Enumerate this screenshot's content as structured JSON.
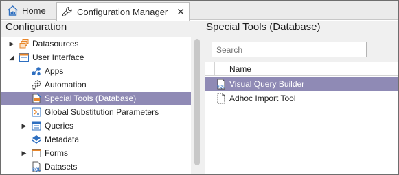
{
  "tabs": [
    {
      "label": "Home",
      "icon": "home-chart-icon"
    },
    {
      "label": "Configuration Manager",
      "icon": "wrench-icon",
      "close": "✕"
    }
  ],
  "left_panel": {
    "title": "Configuration",
    "tree": [
      {
        "label": "Datasources",
        "icon": "datasources-icon",
        "toggle": "▶",
        "level": 0
      },
      {
        "label": "User Interface",
        "icon": "user-interface-icon",
        "toggle": "◢",
        "level": 0
      },
      {
        "label": "Apps",
        "icon": "apps-icon",
        "level": 1
      },
      {
        "label": "Automation",
        "icon": "automation-gear-icon",
        "level": 1
      },
      {
        "label": "Special Tools (Database)",
        "icon": "special-tools-icon",
        "level": 1,
        "selected": true
      },
      {
        "label": "Global Substitution Parameters",
        "icon": "global-parameters-icon",
        "level": 1
      },
      {
        "label": "Queries",
        "icon": "queries-icon",
        "toggle": "▶",
        "level": 1
      },
      {
        "label": "Metadata",
        "icon": "metadata-icon",
        "level": 1
      },
      {
        "label": "Forms",
        "icon": "forms-icon",
        "toggle": "▶",
        "level": 1
      },
      {
        "label": "Datasets",
        "icon": "datasets-sql-icon",
        "level": 1
      }
    ]
  },
  "right_panel": {
    "title": "Special Tools (Database)",
    "search_placeholder": "Search",
    "column_name": "Name",
    "rows": [
      {
        "label": "Visual Query Builder",
        "icon": "sql-document-icon",
        "selected": true
      },
      {
        "label": "Adhoc Import Tool",
        "icon": "document-icon",
        "selected": false
      }
    ]
  },
  "colors": {
    "selection": "#8f8ab5",
    "panel_bg": "#f0f0f0",
    "accent_blue": "#2e6fc0",
    "accent_orange": "#e8862a"
  }
}
